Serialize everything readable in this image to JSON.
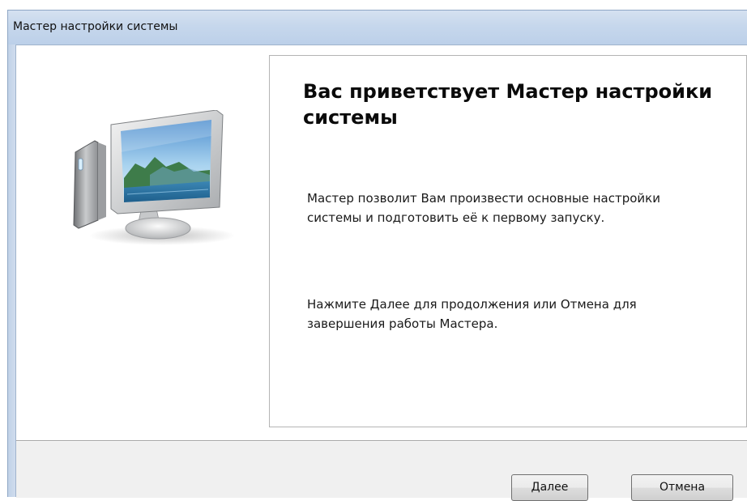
{
  "window": {
    "title": "Мастер настройки системы"
  },
  "welcome": {
    "heading": "Вас приветствует Мастер настройки системы",
    "paragraph1": "Мастер позволит Вам произвести основные настройки системы и подготовить её к первому запуску.",
    "paragraph2": "Нажмите Далее для продолжения или Отмена для завершения работы Мастера."
  },
  "illustration": {
    "icon": "computer-icon"
  },
  "buttons": {
    "next_label": "Далее",
    "cancel_label": "Отмена"
  }
}
